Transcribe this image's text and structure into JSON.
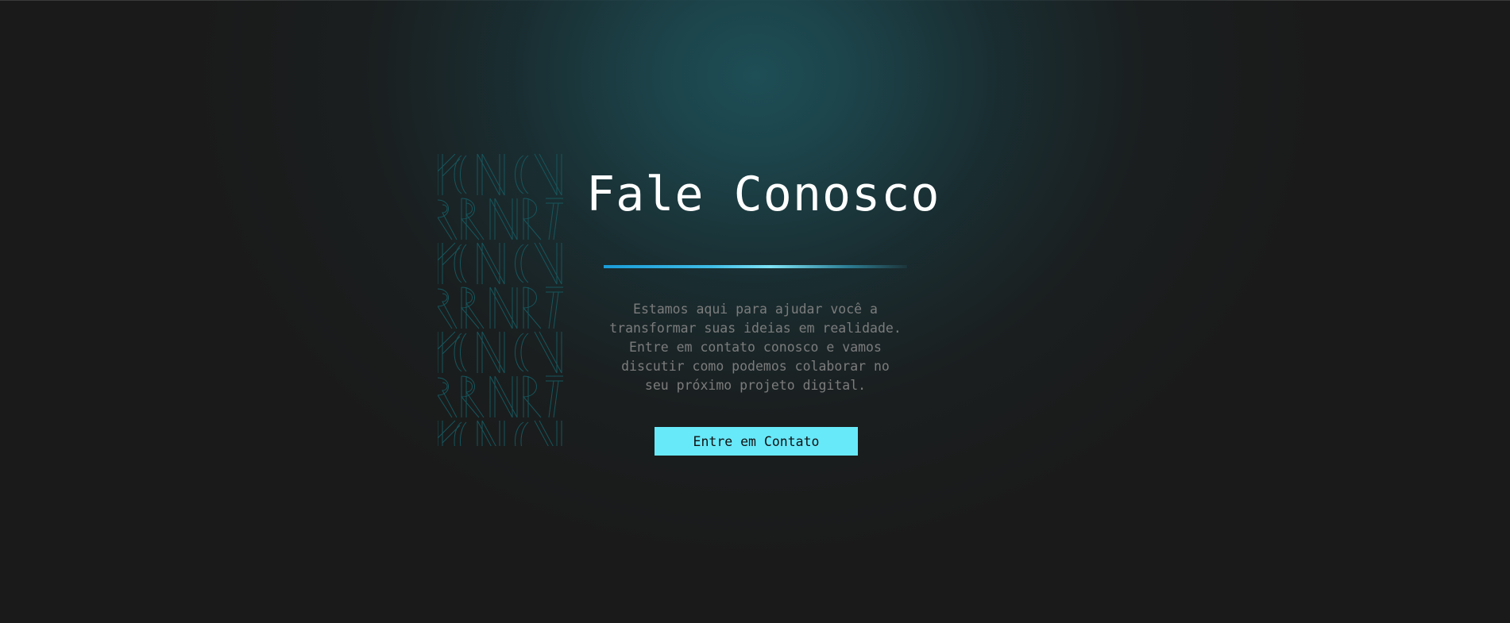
{
  "hero": {
    "title": "Fale Conosco",
    "description": "Estamos aqui para ajudar você a transformar suas ideias em realidade. Entre em contato conosco e vamos discutir como podemos colaborar no seu próximo projeto digital.",
    "cta_label": "Entre em Contato"
  },
  "colors": {
    "background": "#1a1a1a",
    "glow": "#1e4e56",
    "accent": "#68e9fa",
    "divider_start": "#1a9cd8",
    "pattern_stroke": "#16565c",
    "title": "#ffffff",
    "description": "#7c7c7c"
  },
  "decoration": {
    "pattern_icon": "outlined-letter-pattern-icon"
  }
}
